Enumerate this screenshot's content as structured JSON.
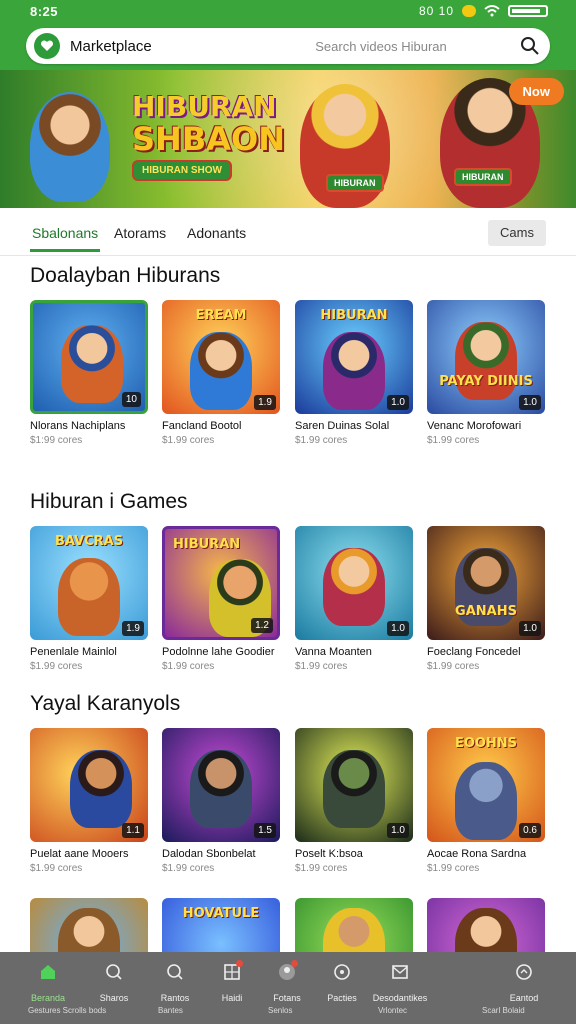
{
  "status_bar": {
    "time": "8:25",
    "indicators": "80 10"
  },
  "header": {
    "app_title": "Marketplace",
    "search_placeholder": "Search videos  Hiburan"
  },
  "banner": {
    "title_line1": "HIBURAN",
    "title_line2": "SHBAON",
    "tagline": "HIBURAN SHOW",
    "char2_label": "HIBURAN",
    "char3_label": "HIBURAN",
    "cta_label": "Now"
  },
  "tabs": {
    "items": [
      "Sbalonans",
      "Atorams",
      "Adonants"
    ],
    "active_index": 0,
    "button_label": "Cams"
  },
  "sections": [
    {
      "title": "Doalayban Hiburans",
      "cards": [
        {
          "name": "Nlorans Nachiplans",
          "sub": "$1:99 cores",
          "badge": "10",
          "art": ""
        },
        {
          "name": "Fancland Bootol",
          "sub": "$1.99 cores",
          "badge": "1.9",
          "art": "EREAM"
        },
        {
          "name": "Saren Duinas Solal",
          "sub": "$1.99 cores",
          "badge": "1.0",
          "art": "HIBURAN"
        },
        {
          "name": "Venanc Morofowari",
          "sub": "$1.99 cores",
          "badge": "1.0",
          "art": "PAYAY DIINIS"
        }
      ]
    },
    {
      "title": "Hiburan i Games",
      "cards": [
        {
          "name": "Penenlale Mainlol",
          "sub": "$1.99 cores",
          "badge": "1.9",
          "art": "BAVCRAS"
        },
        {
          "name": "Podolnne lahe Goodier",
          "sub": "$1.99 cores",
          "badge": "1.2",
          "art": "HIBURAN"
        },
        {
          "name": "Vanna Moanten",
          "sub": "$1.99 cores",
          "badge": "1.0",
          "art": ""
        },
        {
          "name": "Foeclang Foncedel",
          "sub": "$1.99 cores",
          "badge": "1.0",
          "art": "GANAHS"
        }
      ]
    },
    {
      "title": "Yayal Karanyols",
      "cards": [
        {
          "name": "Puelat aane Mooers",
          "sub": "$1.99 cores",
          "badge": "1.1",
          "art": ""
        },
        {
          "name": "Dalodan Sbonbelat",
          "sub": "$1.99 cores",
          "badge": "1.5",
          "art": ""
        },
        {
          "name": "Poselt K:bsoa",
          "sub": "$1.99 cores",
          "badge": "1.0",
          "art": ""
        },
        {
          "name": "Aocae Rona Sardna",
          "sub": "$1.99 cores",
          "badge": "0.6",
          "art": "EOOHNS"
        }
      ]
    },
    {
      "title": "",
      "cards": [
        {
          "name": "",
          "sub": "",
          "badge": "",
          "art": ""
        },
        {
          "name": "",
          "sub": "",
          "badge": "",
          "art": "HOVATULE"
        },
        {
          "name": "",
          "sub": "",
          "badge": "",
          "art": ""
        },
        {
          "name": "",
          "sub": "",
          "badge": "",
          "art": ""
        }
      ]
    }
  ],
  "bottom_nav": {
    "items": [
      {
        "label": "Beranda",
        "icon": "home-icon"
      },
      {
        "label": "Sharos",
        "icon": "search-icon"
      },
      {
        "label": "Rantos",
        "icon": "search-icon"
      },
      {
        "label": "Haidi",
        "icon": "grid-icon"
      },
      {
        "label": "Fotans",
        "icon": "profile-icon"
      },
      {
        "label": "Pacties",
        "icon": "info-icon"
      },
      {
        "label": "Desodantikes",
        "icon": "mail-icon"
      },
      {
        "label": "Eantod",
        "icon": "chat-icon"
      }
    ],
    "footer": [
      "Gestures Scrolls bods",
      "Bantes",
      "Senlos",
      "Vrlontec",
      "Scarl Bolaid"
    ]
  },
  "colors": {
    "brand_green": "#3aa53a",
    "accent_orange": "#f07a22",
    "nav_bg": "#6a6a6a"
  }
}
